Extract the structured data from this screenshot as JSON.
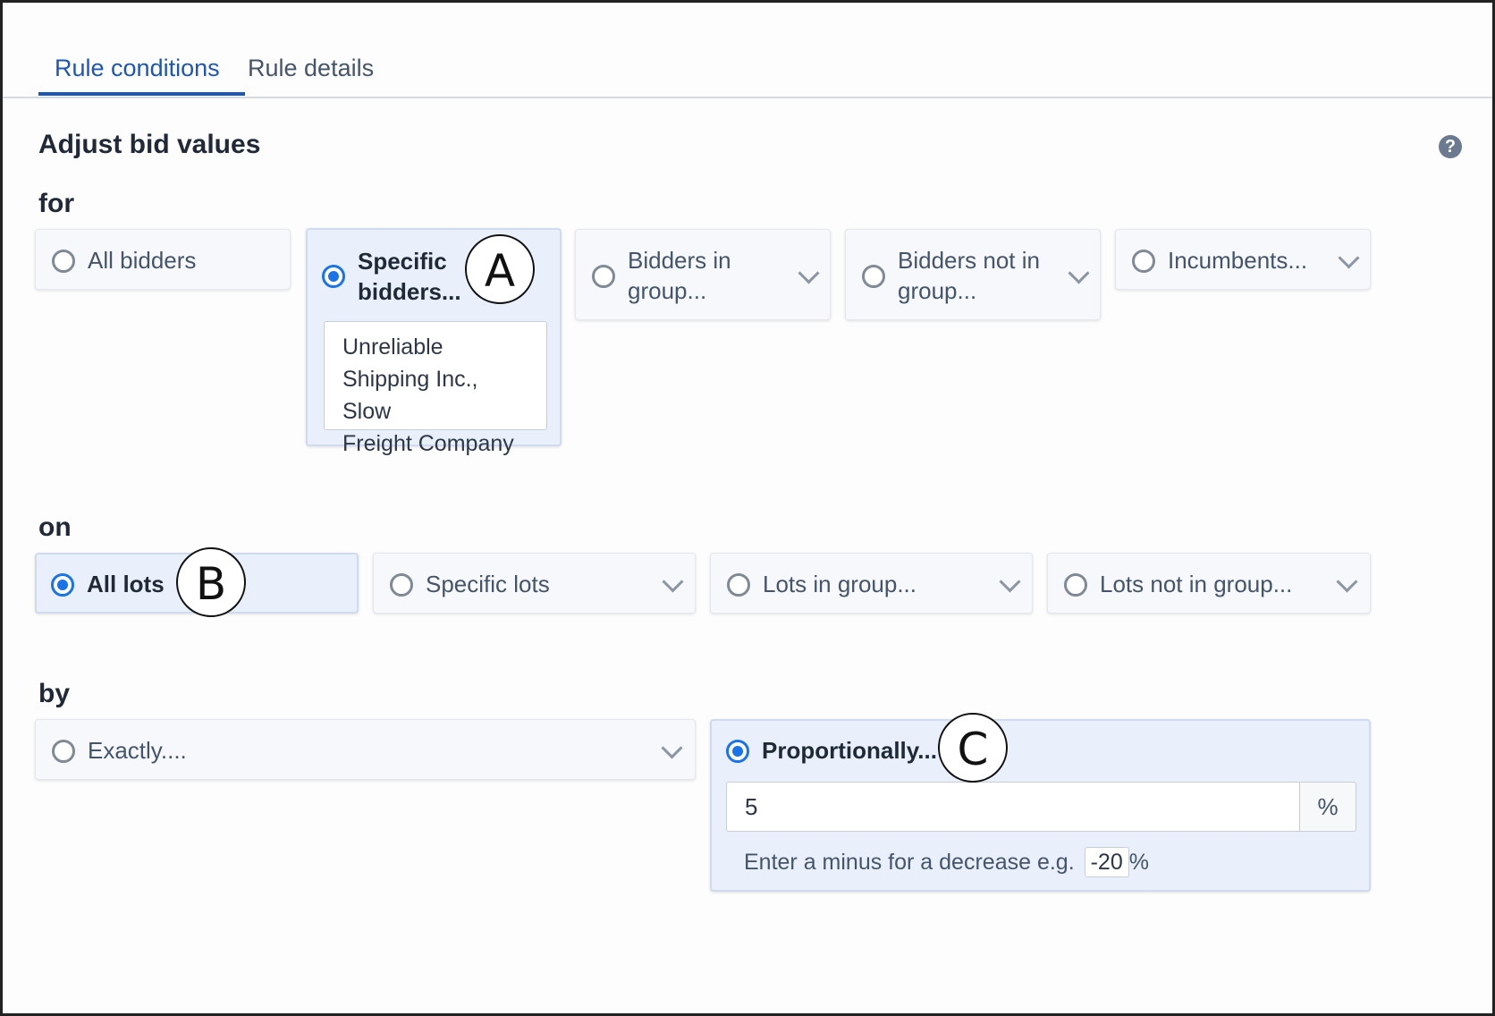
{
  "tabs": [
    {
      "label": "Rule conditions",
      "active": true
    },
    {
      "label": "Rule details",
      "active": false
    }
  ],
  "title": "Adjust bid values",
  "help_icon": "?",
  "for": {
    "label": "for",
    "options": [
      {
        "label": "All bidders",
        "selected": false
      },
      {
        "label_line1": "Specific",
        "label_line2": "bidders...",
        "selected": true,
        "value_lines": [
          "Unreliable",
          "Shipping Inc., Slow",
          "Freight Company"
        ]
      },
      {
        "label_line1": "Bidders in",
        "label_line2": "group...",
        "selected": false
      },
      {
        "label_line1": "Bidders not in",
        "label_line2": "group...",
        "selected": false
      },
      {
        "label": "Incumbents...",
        "selected": false
      }
    ]
  },
  "on": {
    "label": "on",
    "options": [
      {
        "label": "All lots",
        "selected": true
      },
      {
        "label": "Specific lots",
        "selected": false
      },
      {
        "label": "Lots in group...",
        "selected": false
      },
      {
        "label": "Lots not in group...",
        "selected": false
      }
    ]
  },
  "by": {
    "label": "by",
    "options": [
      {
        "label": "Exactly....",
        "selected": false
      },
      {
        "label": "Proportionally...",
        "selected": true,
        "value": "5",
        "unit": "%",
        "hint_text": "Enter a minus for a decrease e.g.",
        "hint_example": "-20",
        "hint_unit": "%"
      }
    ]
  },
  "callouts": {
    "a": "A",
    "b": "B",
    "c": "C"
  },
  "colors": {
    "accent": "#1d56b7",
    "radio_selected": "#1a73e8",
    "selected_card": "#e9f0fb"
  }
}
